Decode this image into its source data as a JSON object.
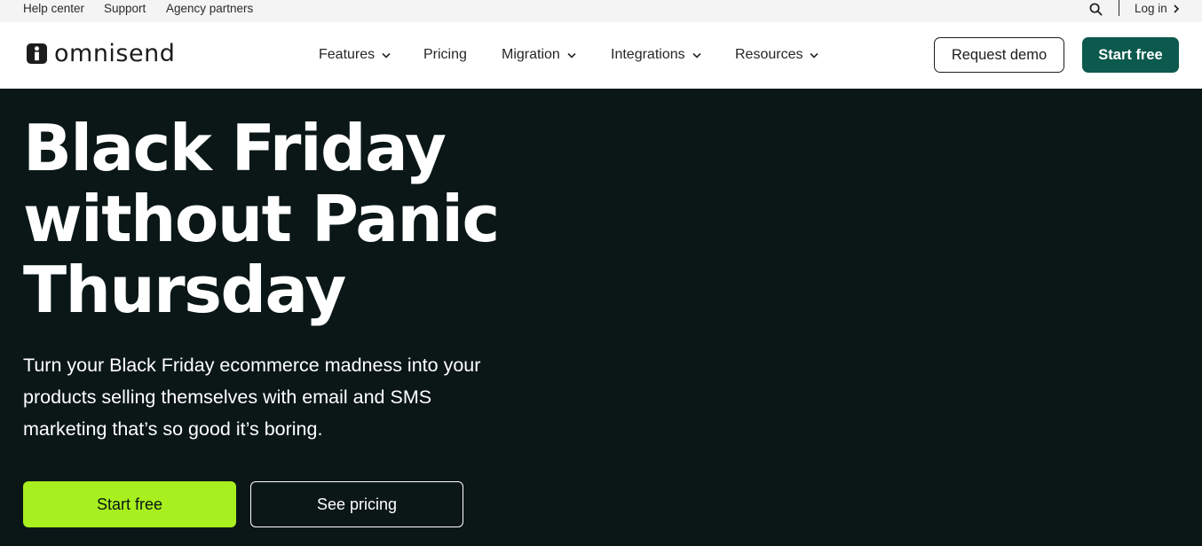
{
  "utility_bar": {
    "links": [
      "Help center",
      "Support",
      "Agency partners"
    ],
    "login_label": "Log in",
    "icons": {
      "search": "search-icon",
      "login_arrow": "chevron-right-icon"
    }
  },
  "nav": {
    "brand": "omnisend",
    "menu": [
      {
        "label": "Features",
        "has_dropdown": true
      },
      {
        "label": "Pricing",
        "has_dropdown": false
      },
      {
        "label": "Migration",
        "has_dropdown": true
      },
      {
        "label": "Integrations",
        "has_dropdown": true
      },
      {
        "label": "Resources",
        "has_dropdown": true
      }
    ],
    "request_demo_label": "Request demo",
    "start_free_label": "Start free"
  },
  "hero": {
    "headline_lines": [
      "Black Friday",
      "without Panic",
      "Thursday"
    ],
    "subtext_lines": [
      "Turn your Black Friday ecommerce madness into your",
      "products selling themselves with email and SMS",
      "marketing that’s so good it’s boring."
    ],
    "primary_cta": "Start free",
    "secondary_cta": "See pricing"
  },
  "colors": {
    "hero_background": "#0a1716",
    "brand_green": "#0c5a4d",
    "cta_lime": "#a7ef1f",
    "utility_bar_bg": "#f4f4f4"
  }
}
